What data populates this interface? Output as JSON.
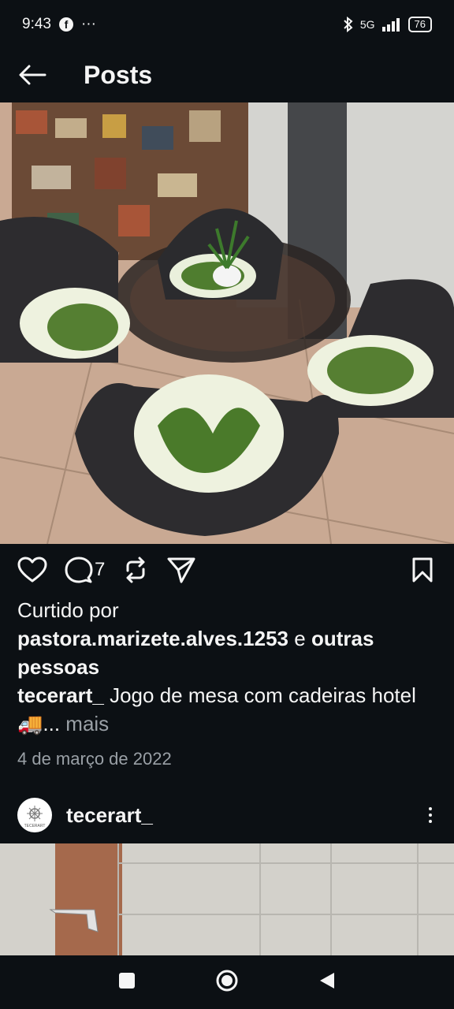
{
  "status": {
    "time": "9:43",
    "fb_icon": "f",
    "dots": "···",
    "network": "5G",
    "battery": "76"
  },
  "header": {
    "title": "Posts"
  },
  "post": {
    "comment_count": "7",
    "liked_prefix": "Curtido por",
    "liker": "pastora.marizete.alves.1253",
    "liked_connector": "e",
    "liked_others": "outras pessoas",
    "author": "tecerart_",
    "caption_text": "Jogo de mesa com cadeiras hotel",
    "caption_emoji": "🚚",
    "ellipsis": "...",
    "more": "mais",
    "date": "4 de março de 2022"
  },
  "next_post": {
    "username": "tecerart_",
    "avatar_text": "TECERART"
  },
  "icons": {
    "back": "back-arrow-icon",
    "like": "heart-icon",
    "comment": "comment-icon",
    "repost": "repost-icon",
    "share": "send-icon",
    "save": "bookmark-icon",
    "more": "more-vertical-icon",
    "nav_recents": "square-icon",
    "nav_home": "circle-icon",
    "nav_back": "triangle-back-icon"
  }
}
